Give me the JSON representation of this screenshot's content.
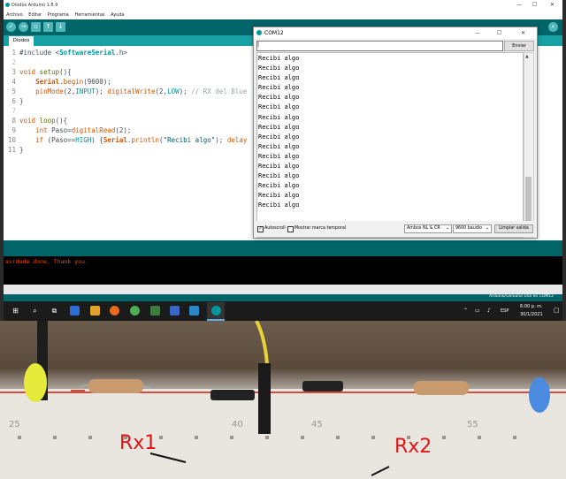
{
  "ide": {
    "title": "Diodos Arduino 1.8.9",
    "menus": [
      "Archivo",
      "Editar",
      "Programa",
      "Herramientas",
      "Ayuda"
    ],
    "tab_name": "Diodos",
    "line_numbers": [
      "1",
      "2",
      "3",
      "4",
      "5",
      "6",
      "7",
      "8",
      "9",
      "10",
      "11"
    ],
    "console_text": "avrdude done.  Thank you.",
    "status_text": "Arduino/Genuino Uno en COM12"
  },
  "serial": {
    "title": "COM12",
    "input_value": "|",
    "send_label": "Enviar",
    "lines": [
      "Recibi algo",
      "Recibi algo",
      "Recibi algo",
      "Recibi algo",
      "Recibi algo",
      "Recibi algo",
      "Recibi algo",
      "Recibi algo",
      "Recibi algo",
      "Recibi algo",
      "Recibi algo",
      "Recibi algo",
      "Recibi algo",
      "Recibi algo",
      "Recibi algo",
      "Recibi algo"
    ],
    "autoscroll_label": "Autoscroll",
    "timestamp_label": "Mostrar marca temporal",
    "line_ending": "Ambos NL & CR",
    "baud": "9600 baudio",
    "clear_label": "Limpiar salida"
  },
  "taskbar": {
    "time": "6:00 p. m.",
    "date": "30/1/2021",
    "lang": "ESP"
  },
  "photo": {
    "labels": [
      "Rx1",
      "Rx2"
    ],
    "board_numbers": [
      "25",
      "40",
      "45",
      "55"
    ]
  },
  "colors": {
    "arduino_teal": "#00979c",
    "toolbar_dark": "#006468",
    "console_orange": "#e34c00",
    "label_red": "#e01515"
  }
}
